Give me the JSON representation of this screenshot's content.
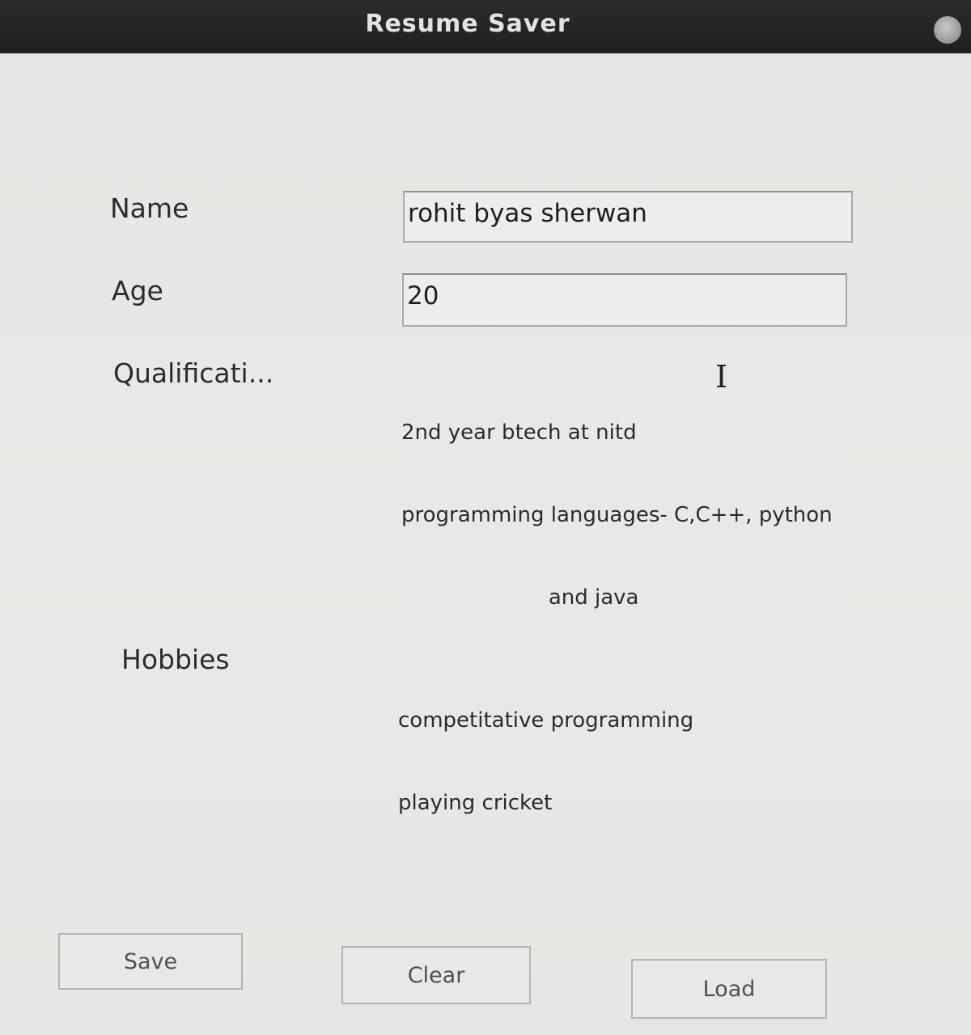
{
  "window": {
    "title": "Resume Saver"
  },
  "form": {
    "name_label": "Name",
    "name_value": "rohit byas sherwan",
    "age_label": "Age",
    "age_value": "20",
    "qualification_label": "Qualificati...",
    "qualification_lines": [
      "2nd year btech at nitd",
      "programming languages- C,C++, python",
      "                      and java"
    ],
    "hobbies_label": "Hobbies",
    "hobbies_lines": [
      "competitative programming",
      "playing cricket"
    ]
  },
  "buttons": {
    "save_label": "Save",
    "clear_label": "Clear",
    "load_label": "Load"
  },
  "icons": {
    "close": "close-icon",
    "text_cursor": "text-cursor-icon"
  }
}
